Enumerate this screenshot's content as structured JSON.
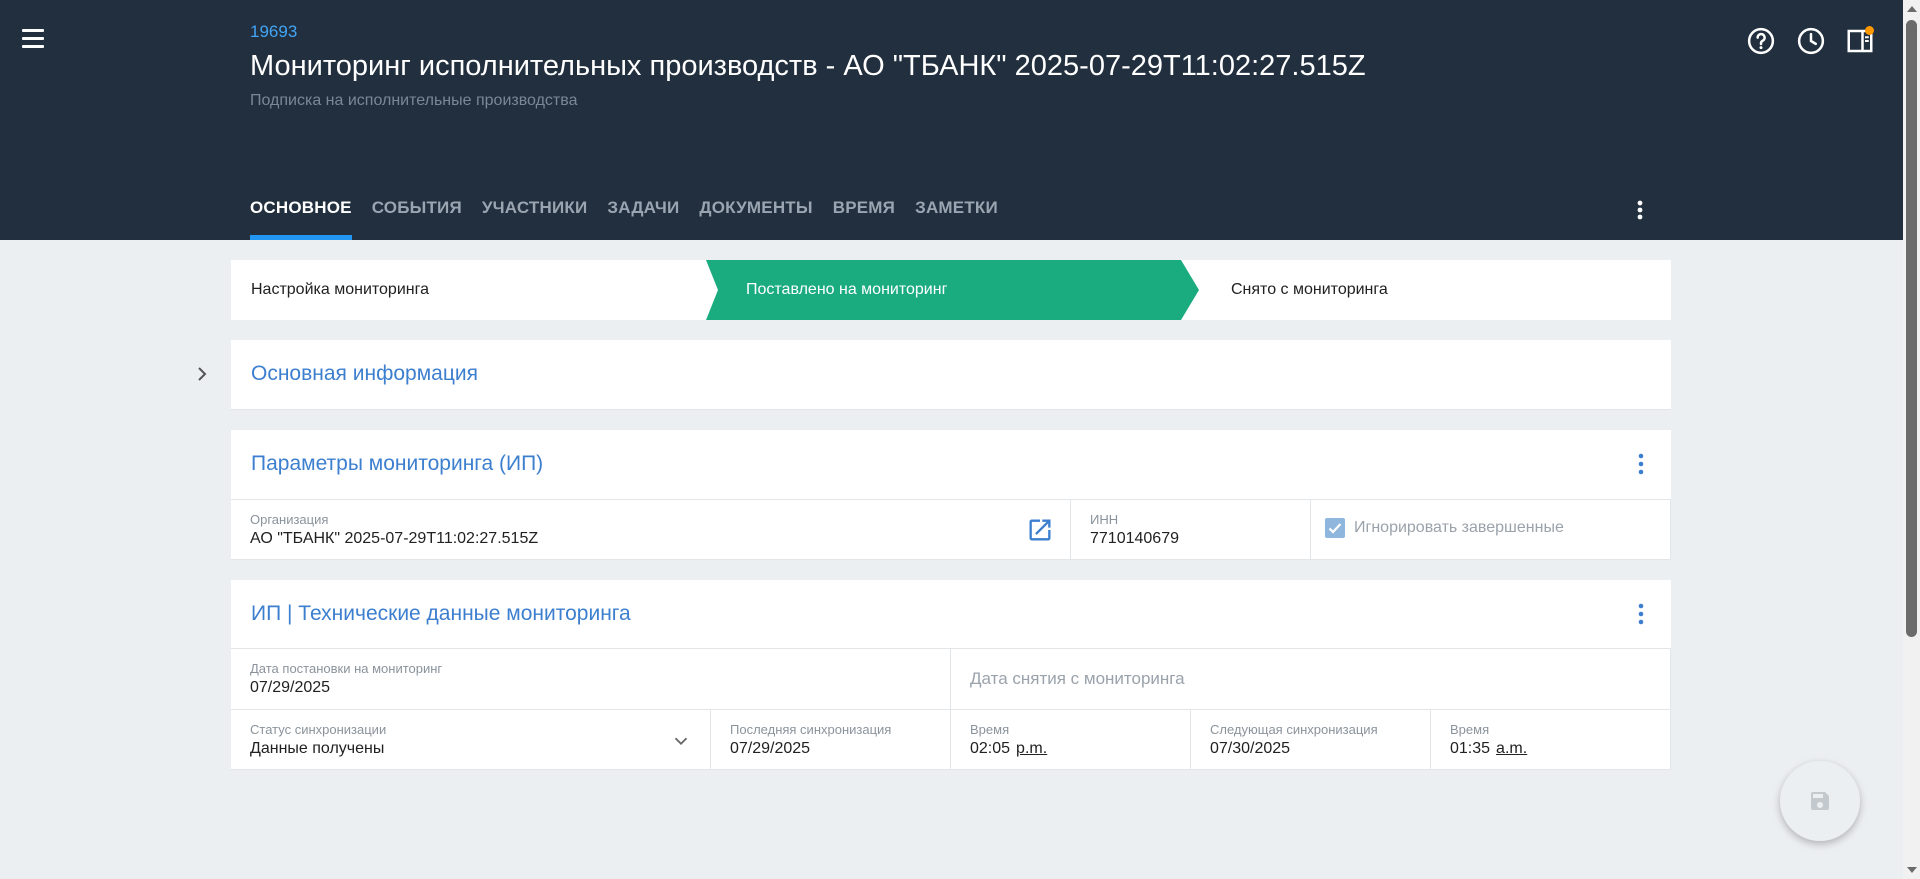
{
  "header": {
    "record_id": "19693",
    "title": "Мониторинг исполнительных производств - АО \"ТБАНК\" 2025-07-29T11:02:27.515Z",
    "subtitle": "Подписка на исполнительные производства",
    "icons": [
      "menu-icon",
      "help-icon",
      "history-icon",
      "side-panel-icon",
      "more-vert-icon"
    ],
    "notification_color": "#ff9800"
  },
  "tabs": [
    {
      "label": "ОСНОВНОЕ",
      "active": true
    },
    {
      "label": "СОБЫТИЯ",
      "active": false
    },
    {
      "label": "УЧАСТНИКИ",
      "active": false
    },
    {
      "label": "ЗАДАЧИ",
      "active": false
    },
    {
      "label": "ДОКУМЕНТЫ",
      "active": false
    },
    {
      "label": "ВРЕМЯ",
      "active": false
    },
    {
      "label": "ЗАМЕТКИ",
      "active": false
    }
  ],
  "stepper": [
    {
      "label": "Настройка мониторинга",
      "active": false
    },
    {
      "label": "Поставлено на мониторинг",
      "active": true
    },
    {
      "label": "Снято с мониторинга",
      "active": false
    }
  ],
  "colors": {
    "header_bg": "#212f3e",
    "accent": "#2196f3",
    "step_active": "#1aab7f",
    "section_title": "#3d7fcf"
  },
  "section_main": {
    "title": "Основная информация"
  },
  "section_params": {
    "title": "Параметры мониторинга (ИП)",
    "organization": {
      "label": "Организация",
      "value": "АО \"ТБАНК\"  2025-07-29T11:02:27.515Z"
    },
    "inn": {
      "label": "ИНН",
      "value": "7710140679"
    },
    "ignore_completed": {
      "label": "Игнорировать завершенные",
      "checked": true
    }
  },
  "section_tech": {
    "title": "ИП | Технические данные мониторинга",
    "date_start": {
      "label": "Дата постановки на мониторинг",
      "value": "07/29/2025"
    },
    "date_end": {
      "placeholder": "Дата снятия с мониторинга"
    },
    "sync_status": {
      "label": "Статус синхронизации",
      "value": "Данные получены"
    },
    "last_sync": {
      "label": "Последняя синхронизация",
      "value": "07/29/2025"
    },
    "last_sync_time": {
      "label": "Время",
      "value": "02:05",
      "ampm": "p.m."
    },
    "next_sync": {
      "label": "Следующая синхронизация",
      "value": "07/30/2025"
    },
    "next_sync_time": {
      "label": "Время",
      "value": "01:35",
      "ampm": "a.m."
    }
  },
  "fab": {
    "icon": "save-icon"
  }
}
